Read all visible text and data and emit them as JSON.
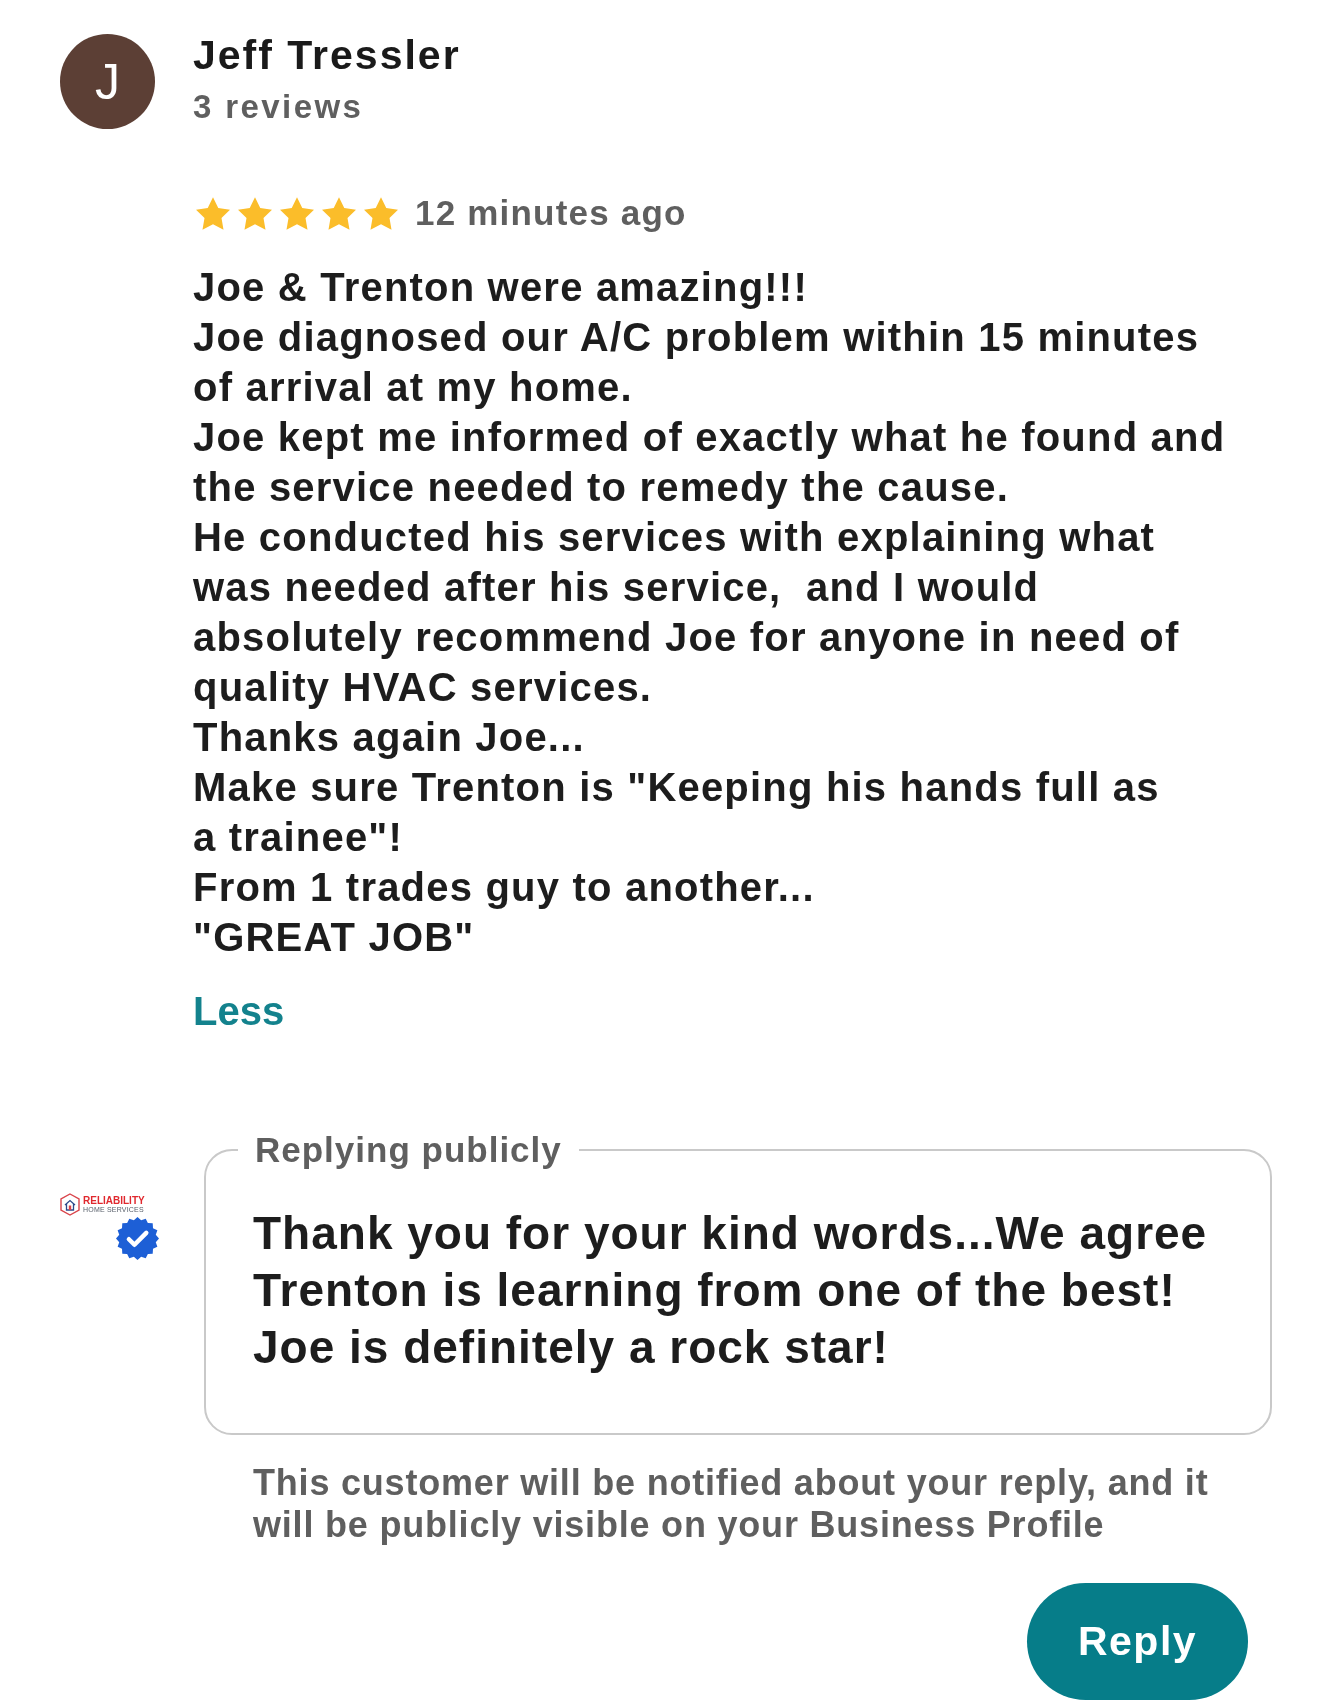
{
  "reviewer": {
    "avatar_letter": "J",
    "name": "Jeff Tressler",
    "review_count": "3 reviews"
  },
  "review": {
    "stars": 5,
    "time": "12 minutes ago",
    "text": "Joe & Trenton were amazing!!!\nJoe diagnosed our A/C problem within 15 minutes\nof arrival at my home.\nJoe kept me informed of exactly what he found and\nthe service needed to remedy the cause.\nHe conducted his services with explaining what\nwas needed after his service,  and I would\nabsolutely recommend Joe for anyone in need of\nquality HVAC services.\nThanks again Joe...\nMake sure Trenton is \"Keeping his hands full as\na trainee\"!\nFrom 1 trades guy to another...\n\"GREAT JOB\"",
    "toggle_link": "Less"
  },
  "reply": {
    "logo": {
      "wordmark": "RELIABILITY",
      "tagline": "HOME SERVICES"
    },
    "verified": true,
    "label": "Replying publicly",
    "value": "Thank you for your kind words...We agree\nTrenton is learning from one of the best!\nJoe is definitely a rock star!",
    "notice": "This customer will be notified about your reply, and it\nwill be publicly visible on your Business Profile",
    "button": "Reply"
  }
}
